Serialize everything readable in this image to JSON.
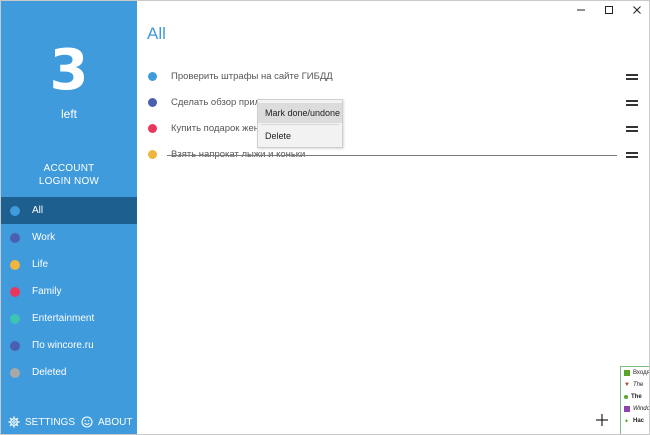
{
  "sidebar": {
    "count": "3",
    "count_label": "left",
    "account_line1": "ACCOUNT",
    "account_line2": "LOGIN NOW",
    "categories": [
      {
        "label": "All",
        "color": "#3f9bdc",
        "active": true
      },
      {
        "label": "Work",
        "color": "#4a5fb0"
      },
      {
        "label": "Life",
        "color": "#f0b53c"
      },
      {
        "label": "Family",
        "color": "#e8365d"
      },
      {
        "label": "Entertainment",
        "color": "#3cc4b0"
      },
      {
        "label": "По wincore.ru",
        "color": "#4a5fb0"
      },
      {
        "label": "Deleted",
        "color": "#a8a8a8"
      }
    ],
    "settings_label": "SETTINGS",
    "about_label": "ABOUT"
  },
  "main": {
    "heading": "All",
    "tasks": [
      {
        "text": "Проверить штрафы на сайте ГИБДД",
        "color": "#3f9bdc",
        "done": false
      },
      {
        "text": "Сделать обзор прилож",
        "color": "#4a5fb0",
        "done": false
      },
      {
        "text": "Купить подарок жене!!",
        "color": "#e8365d",
        "done": false
      },
      {
        "text": "Взять напрокат лыжи и коньки",
        "color": "#f0b53c",
        "done": true
      }
    ]
  },
  "context_menu": {
    "items": [
      "Mark done/undone",
      "Delete"
    ]
  },
  "peek_window": {
    "rows": [
      "Входя",
      "The",
      "The",
      "Windo",
      "Hac"
    ]
  },
  "icons": {
    "settings": "gear-icon",
    "about": "smiley-icon",
    "add": "plus-icon",
    "minimize": "minimize-icon",
    "maximize": "maximize-icon",
    "close": "close-icon",
    "reorder": "drag-handle-icon"
  }
}
